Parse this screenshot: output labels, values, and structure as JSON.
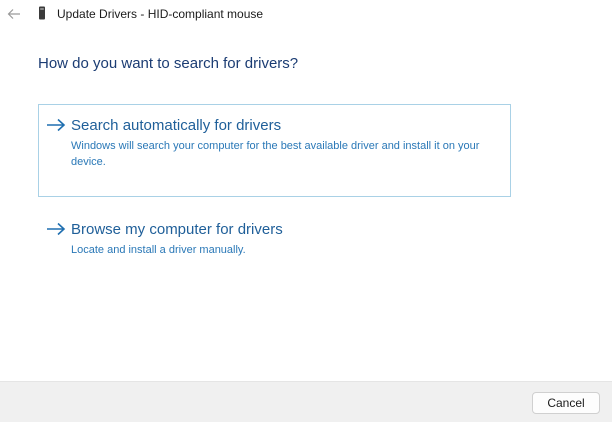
{
  "window": {
    "title": "Update Drivers - HID-compliant mouse",
    "back_icon": "back-arrow-icon",
    "device_icon": "device-icon"
  },
  "main": {
    "heading": "How do you want to search for drivers?",
    "options": [
      {
        "title": "Search automatically for drivers",
        "description": "Windows will search your computer for the best available driver and install it on your device.",
        "icon": "arrow-right-icon"
      },
      {
        "title": "Browse my computer for drivers",
        "description": "Locate and install a driver manually.",
        "icon": "arrow-right-icon"
      }
    ]
  },
  "footer": {
    "cancel_label": "Cancel"
  },
  "colors": {
    "heading": "#1b3c73",
    "link": "#1f5f99",
    "selected_border": "#a9d1e6"
  }
}
